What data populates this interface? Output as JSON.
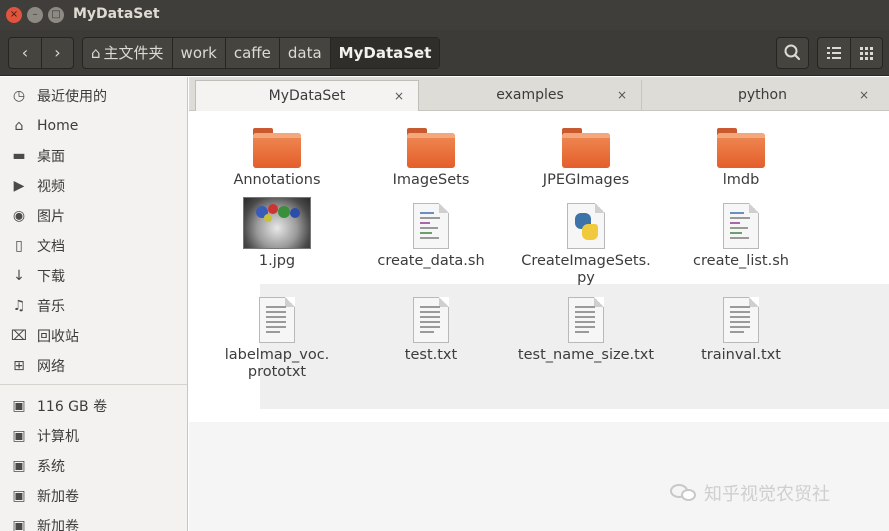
{
  "window": {
    "title": "MyDataSet"
  },
  "window_controls": {
    "close": "×",
    "minimize": "–",
    "maximize": "□"
  },
  "toolbar": {
    "back": "‹",
    "forward": "›",
    "breadcrumbs": [
      {
        "label": "主文件夹",
        "icon": "home-icon"
      },
      {
        "label": "work"
      },
      {
        "label": "caffe"
      },
      {
        "label": "data"
      },
      {
        "label": "MyDataSet",
        "active": true
      }
    ]
  },
  "sidebar": {
    "items": [
      {
        "label": "最近使用的",
        "icon": "clock-icon",
        "glyph": "◷"
      },
      {
        "label": "Home",
        "icon": "home-icon",
        "glyph": "⌂"
      },
      {
        "label": "桌面",
        "icon": "folder-icon",
        "glyph": "▬"
      },
      {
        "label": "视频",
        "icon": "video-icon",
        "glyph": "▶"
      },
      {
        "label": "图片",
        "icon": "camera-icon",
        "glyph": "◉"
      },
      {
        "label": "文档",
        "icon": "document-icon",
        "glyph": "▯"
      },
      {
        "label": "下载",
        "icon": "download-icon",
        "glyph": "↓"
      },
      {
        "label": "音乐",
        "icon": "music-icon",
        "glyph": "♫"
      },
      {
        "label": "回收站",
        "icon": "trash-icon",
        "glyph": "⌧"
      },
      {
        "label": "网络",
        "icon": "network-icon",
        "glyph": "⊞"
      },
      {
        "label": "116 GB 卷",
        "icon": "drive-icon",
        "glyph": "▣"
      },
      {
        "label": "计算机",
        "icon": "drive-icon",
        "glyph": "▣"
      },
      {
        "label": "系统",
        "icon": "drive-icon",
        "glyph": "▣"
      },
      {
        "label": "新加卷",
        "icon": "drive-icon",
        "glyph": "▣"
      },
      {
        "label": "新加卷",
        "icon": "drive-icon",
        "glyph": "▣"
      }
    ]
  },
  "tabs": [
    {
      "label": "MyDataSet",
      "active": true
    },
    {
      "label": "examples"
    },
    {
      "label": "python"
    }
  ],
  "tab_close": "×",
  "files": [
    {
      "name": "Annotations",
      "type": "folder"
    },
    {
      "name": "ImageSets",
      "type": "folder"
    },
    {
      "name": "JPEGImages",
      "type": "folder"
    },
    {
      "name": "lmdb",
      "type": "folder"
    },
    {
      "name": "1.jpg",
      "type": "image"
    },
    {
      "name": "create_data.sh",
      "type": "script"
    },
    {
      "name": "CreateImageSets.\npy",
      "type": "python"
    },
    {
      "name": "create_list.sh",
      "type": "script"
    },
    {
      "name": "labelmap_voc.\nprototxt",
      "type": "text"
    },
    {
      "name": "test.txt",
      "type": "text"
    },
    {
      "name": "test_name_size.txt",
      "type": "text"
    },
    {
      "name": "trainval.txt",
      "type": "text"
    }
  ],
  "watermark": {
    "text": "知乎视觉农贸社"
  },
  "colors": {
    "folder": "#e45e2a",
    "titlebar": "#3f3e3a",
    "close": "#e0543e"
  }
}
